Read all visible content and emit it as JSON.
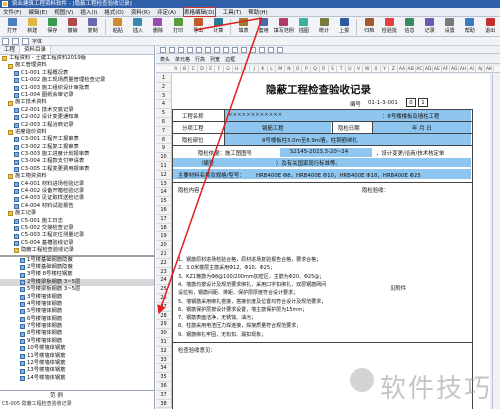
{
  "window": {
    "title": "筑业建筑工程资料软件 - [隐蔽工程检查验收记录]"
  },
  "menu": {
    "items": [
      "文件(F)",
      "编辑(E)",
      "视图(V)",
      "插入(I)",
      "格式(O)",
      "资料(R)",
      "评定(A)",
      "表格编辑(D)",
      "工具(T)",
      "帮助(H)"
    ],
    "selected_index": 7
  },
  "toolbar": {
    "buttons": [
      "打开",
      "新建",
      "保存",
      "撤销",
      "复制",
      "粘贴",
      "插入",
      "删除",
      "打印",
      "导出",
      "计算",
      "填表",
      "套用",
      "填写范例",
      "插图",
      "统计",
      "上报",
      "归档",
      "检验批",
      "信息",
      "记录",
      "设置",
      "帮助",
      "退出"
    ]
  },
  "tabs": [
    {
      "label": "工程",
      "active": false
    },
    {
      "label": "资料目录",
      "active": true
    }
  ],
  "tree": {
    "nodes": [
      {
        "text": "工程资料 - 土建工程资料2019版",
        "icon": "folder",
        "indent": 0
      },
      {
        "text": "施工管理资料",
        "icon": "folder",
        "indent": 1
      },
      {
        "text": "C1-001 工程概况表",
        "icon": "doc",
        "indent": 2
      },
      {
        "text": "C1-002 施工现场质量管理检查记录",
        "icon": "doc",
        "indent": 2
      },
      {
        "text": "C1-003 施工组织设计审批表",
        "icon": "doc",
        "indent": 2
      },
      {
        "text": "C1-004 图纸会审记录",
        "icon": "doc",
        "indent": 2
      },
      {
        "text": "施工技术资料",
        "icon": "folder",
        "indent": 1
      },
      {
        "text": "C2-001 技术交底记录",
        "icon": "doc",
        "indent": 2
      },
      {
        "text": "C2-002 设计变更通知单",
        "icon": "doc",
        "indent": 2
      },
      {
        "text": "C2-003 工程洽商记录",
        "icon": "doc",
        "indent": 2
      },
      {
        "text": "进度造价资料",
        "icon": "folder",
        "indent": 1
      },
      {
        "text": "C3-001 工程开工报审表",
        "icon": "doc",
        "indent": 2
      },
      {
        "text": "C3-002 工程复工报审表",
        "icon": "doc",
        "indent": 2
      },
      {
        "text": "C3-003 施工进度计划报审表",
        "icon": "doc",
        "indent": 2
      },
      {
        "text": "C3-004 工程款支付申请表",
        "icon": "doc",
        "indent": 2
      },
      {
        "text": "C3-005 工程变更费用报审表",
        "icon": "doc",
        "indent": 2
      },
      {
        "text": "施工物资资料",
        "icon": "folder",
        "indent": 1
      },
      {
        "text": "C4-001 材料进场检验记录",
        "icon": "doc",
        "indent": 2
      },
      {
        "text": "C4-002 设备开箱检验记录",
        "icon": "doc",
        "indent": 2
      },
      {
        "text": "C4-003 见证取样送检记录",
        "icon": "doc",
        "indent": 2
      },
      {
        "text": "C4-004 材料试验报告",
        "icon": "doc",
        "indent": 2
      },
      {
        "text": "施工记录",
        "icon": "folder",
        "indent": 1
      },
      {
        "text": "C5-001 施工日志",
        "icon": "doc",
        "indent": 2
      },
      {
        "text": "C5-002 交接检查记录",
        "icon": "doc",
        "indent": 2
      },
      {
        "text": "C5-003 工程定位测量记录",
        "icon": "doc",
        "indent": 2
      },
      {
        "text": "C5-004 基槽验线记录",
        "icon": "doc",
        "indent": 2
      },
      {
        "text": "隐蔽工程检查验收记录",
        "icon": "folder",
        "indent": 2
      },
      {
        "text": "1号楼基础钢筋隐蔽",
        "icon": "doc",
        "indent": 3
      },
      {
        "text": "2号楼基础钢筋隐蔽",
        "icon": "doc",
        "indent": 3
      },
      {
        "text": "3号楼 8号楼柱钢筋",
        "icon": "doc",
        "indent": 3
      },
      {
        "text": "2号楼梁板钢筋 3~5层",
        "icon": "doc",
        "indent": 3
      },
      {
        "text": "5号楼梁板钢筋 3~5层",
        "icon": "doc",
        "indent": 3
      },
      {
        "text": "3号楼墙体钢筋",
        "icon": "doc",
        "indent": 3
      },
      {
        "text": "4号楼墙体钢筋",
        "icon": "doc",
        "indent": 3
      },
      {
        "text": "5号楼墙体钢筋",
        "icon": "doc",
        "indent": 3
      },
      {
        "text": "6号楼墙体钢筋",
        "icon": "doc",
        "indent": 3
      },
      {
        "text": "7号楼墙体钢筋",
        "icon": "doc",
        "indent": 3
      },
      {
        "text": "8号楼墙体钢筋",
        "icon": "doc",
        "indent": 3
      },
      {
        "text": "9号楼墙体钢筋",
        "icon": "doc",
        "indent": 3
      },
      {
        "text": "10号楼墙体钢筋",
        "icon": "doc",
        "indent": 3
      },
      {
        "text": "11号楼墙体钢筋",
        "icon": "doc",
        "indent": 3
      },
      {
        "text": "12号楼墙体钢筋",
        "icon": "doc",
        "indent": 3
      },
      {
        "text": "13号楼墙体钢筋",
        "icon": "doc",
        "indent": 3
      },
      {
        "text": "14号楼墙体钢筋",
        "icon": "doc",
        "indent": 3
      }
    ],
    "selected_index": 30
  },
  "left_bottom": {
    "label": "范 例",
    "status": "C5-005 隐蔽工程检查验收记录"
  },
  "toolbar2_label": "字体",
  "format_bar": {
    "items": [
      "表头",
      "单元格",
      "行高",
      "列宽",
      "边框"
    ]
  },
  "columns": [
    "A",
    "B",
    "C",
    "D",
    "E",
    "F",
    "G",
    "H",
    "I",
    "J",
    "K",
    "L",
    "M",
    "N",
    "O",
    "P",
    "Q",
    "R",
    "S",
    "T",
    "U",
    "V",
    "W",
    "X",
    "Y",
    "Z",
    "AA",
    "AB",
    "AC",
    "AD",
    "AE",
    "AF",
    "AG",
    "AH",
    "AI",
    "AJ",
    "AK"
  ],
  "rows": [
    "1",
    "2",
    "3",
    "4",
    "5",
    "6",
    "7",
    "8",
    "9",
    "10",
    "11",
    "12",
    "13",
    "14",
    "15",
    "16",
    "17",
    "18",
    "19",
    "20",
    "21",
    "22",
    "23",
    "24",
    "25",
    "26",
    "27",
    "28",
    "29",
    "30",
    "31",
    "32",
    "33",
    "34",
    "35",
    "36",
    "37",
    "38"
  ],
  "form": {
    "title": "隐蔽工程检查验收记录",
    "code_label": "编号",
    "code_value": "01-1-3-001",
    "code_boxes": [
      "0",
      "1"
    ],
    "project_name_label": "工程名称",
    "project_name_value": "××××××××××××",
    "project_suffix": "：8号楼楼板及墙柱工程",
    "subitem_label": "分项工程",
    "subitem_value": "钢筋工程",
    "check_date_label": "隐检日期",
    "check_date_value": "年  月  日",
    "location_label": "隐检部位",
    "location_value": "8号楼板柱3.0m至8.9m墙，柱钢筋绑扎",
    "basis_label": "隐检依据：施工图图号",
    "basis_value": "S2145-2023,3-20~24",
    "basis_suffix": "，设计变更/洽商/技术核定单",
    "number_label": "（编号",
    "number_suffix": "）及有关国家现行标准等。",
    "material_label": "主要材料名称及规格/型号：",
    "material_value": "HRB400E Φ8，HRB400E Φ10，HRB400E Φ18，HRB400E Φ25",
    "content_label": "隐检内容：",
    "content_side_label": "隐检验收：",
    "content_lines": [
      "1、钢筋原材进场检验合格，原材进场复验报告合格，要求合格；",
      "2、3.0米楼层主筋采用Φ12、Φ10、Φ25；",
      "3、KZ1箍筋为Φ8@100/200mm加密区，主筋为Φ20、Φ25@；",
      "4、墙筋均按设计及规范要求绑扎，采用口字扣绑扎，双层钢筋网间",
      "   设拉钩，钢筋间距、排距、保护层厚度符合设计要求；",
      "5、墙钢筋采用绑扎搭接，搭接长度及位置均符合设计及规范要求，",
      "6、钢筋保护层按设计要求设置，墙主筋保护层为15mm；",
      "7、钢筋表面洁净，无锈蚀、油污；",
      "8、柱筋采用电渣压力焊连接，焊接质量符合规范要求；",
      "9、钢筋绑扎牢固，无松扣、漏扣现象；"
    ],
    "inspect_label": "检查验收意见：",
    "approved_label": "见附件"
  }
}
